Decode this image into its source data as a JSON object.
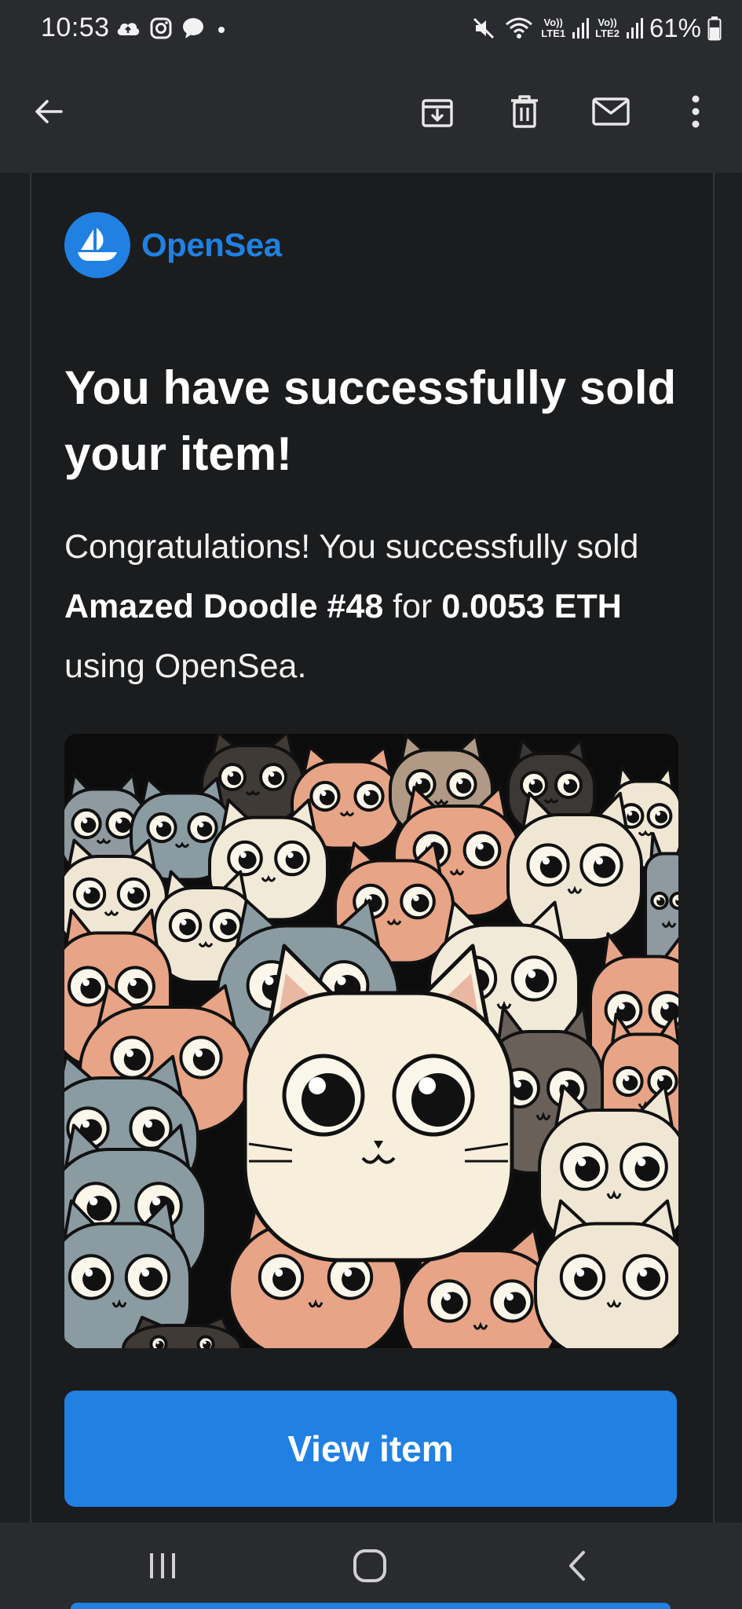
{
  "status_bar": {
    "time": "10:53",
    "left_icons": [
      "cloud-upload-icon",
      "instagram-icon",
      "chat-bubble-icon",
      "notification-dot-icon"
    ],
    "right_icons": [
      "mute-icon",
      "wifi-icon",
      "signal-sim1-icon",
      "signal-sim2-icon",
      "battery-icon"
    ],
    "sim1_tag_top": "Vo))",
    "sim1_tag_bottom": "LTE1",
    "sim2_tag_top": "Vo))",
    "sim2_tag_bottom": "LTE2",
    "battery_percent": "61%",
    "battery_level": 0.61
  },
  "app_bar": {
    "actions": [
      "back-arrow-icon",
      "archive-icon",
      "delete-icon",
      "mark-unread-icon",
      "more-options-icon"
    ]
  },
  "email": {
    "brand_name": "OpenSea",
    "headline": "You have successfully sold your item!",
    "message_intro": "Congratulations! You successfully sold ",
    "item_name": "Amazed Doodle #48",
    "message_for": " for ",
    "price": "0.0053 ETH",
    "message_outro": " using OpenSea.",
    "image_icon": "nft-cats-artwork",
    "button_label": "View item"
  },
  "colors": {
    "accent": "#2081e2",
    "background": "#1e1f21",
    "bar": "#2a2b2e"
  },
  "nav_bar": {
    "buttons": [
      "recent-apps-icon",
      "home-icon",
      "back-icon"
    ]
  }
}
